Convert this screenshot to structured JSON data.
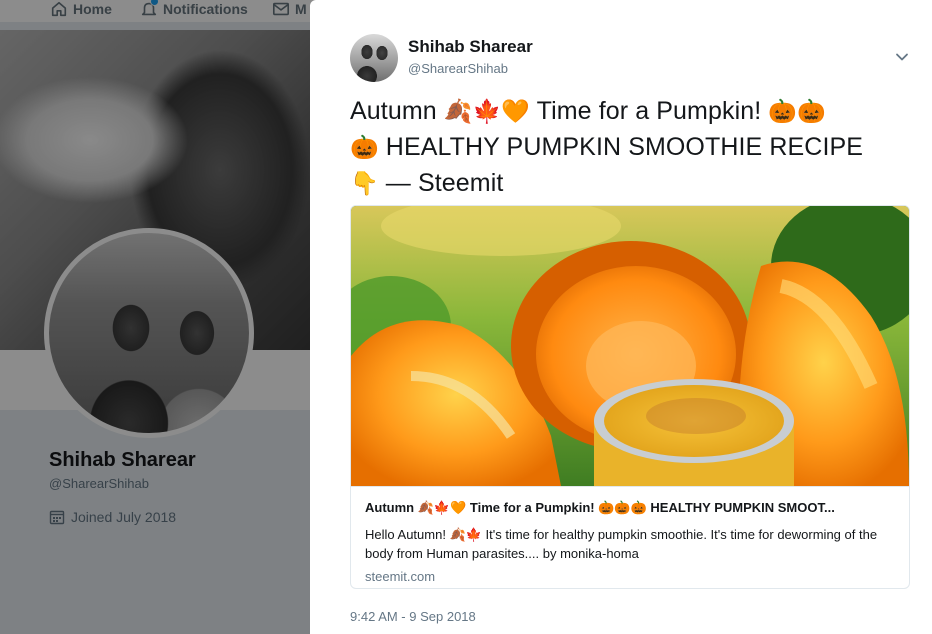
{
  "nav": {
    "home_label": "Home",
    "notifications_label": "Notifications",
    "messages_label": "M"
  },
  "profile": {
    "name": "Shihab Sharear",
    "handle": "@SharearShihab",
    "joined": "Joined July 2018"
  },
  "tweet": {
    "author_name": "Shihab Sharear",
    "author_handle": "@SharearShihab",
    "text_line1_start": "Autumn ",
    "text_line1_emoji": "🍂🍁🧡",
    "text_line1_end": " Time for a Pumpkin! ",
    "text_line1_emoji2": "🎃🎃",
    "text_line2_emoji": "🎃",
    "text_line2_text": " HEALTHY PUMPKIN SMOOTHIE RECIPE",
    "text_line3_emoji": "👇",
    "text_line3_text": " — Steemit",
    "timestamp": "9:42 AM - 9 Sep 2018"
  },
  "card": {
    "title": "Autumn 🍂🍁🧡 Time for a Pumpkin! 🎃🎃🎃 HEALTHY PUMPKIN SMOOT...",
    "description": "Hello Autumn! 🍂🍁 It's time for healthy pumpkin smoothie. It's time for deworming of the body from Human parasites.... by monika-homa",
    "domain": "steemit.com"
  },
  "colors": {
    "accent": "#1da1f2",
    "text_primary": "#14171a",
    "text_secondary": "#657786"
  },
  "icons": {
    "home": "home-icon",
    "notifications": "bell-icon",
    "messages": "envelope-icon",
    "calendar": "calendar-icon",
    "caret": "chevron-down-icon"
  }
}
